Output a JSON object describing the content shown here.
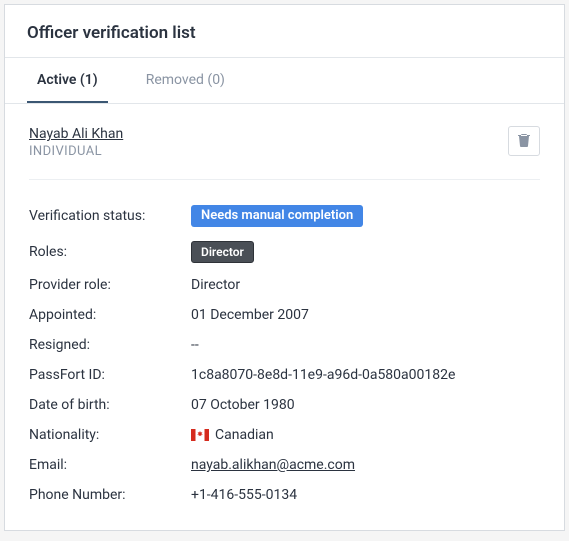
{
  "header": {
    "title": "Officer verification list"
  },
  "tabs": {
    "active": {
      "label": "Active (1)"
    },
    "removed": {
      "label": "Removed (0)"
    }
  },
  "officer": {
    "name": "Nayab Ali Khan",
    "type": "INDIVIDUAL"
  },
  "details": {
    "verification_status": {
      "label": "Verification status:",
      "value": "Needs manual completion"
    },
    "roles": {
      "label": "Roles:",
      "value": "Director"
    },
    "provider_role": {
      "label": "Provider role:",
      "value": "Director"
    },
    "appointed": {
      "label": "Appointed:",
      "value": "01 December 2007"
    },
    "resigned": {
      "label": "Resigned:",
      "value": "--"
    },
    "passfort_id": {
      "label": "PassFort ID:",
      "value": "1c8a8070-8e8d-11e9-a96d-0a580a00182e"
    },
    "dob": {
      "label": "Date of birth:",
      "value": "07 October 1980"
    },
    "nationality": {
      "label": "Nationality:",
      "value": "Canadian"
    },
    "email": {
      "label": "Email:",
      "value": "nayab.alikhan@acme.com"
    },
    "phone": {
      "label": "Phone Number:",
      "value": "+1-416-555-0134"
    }
  }
}
